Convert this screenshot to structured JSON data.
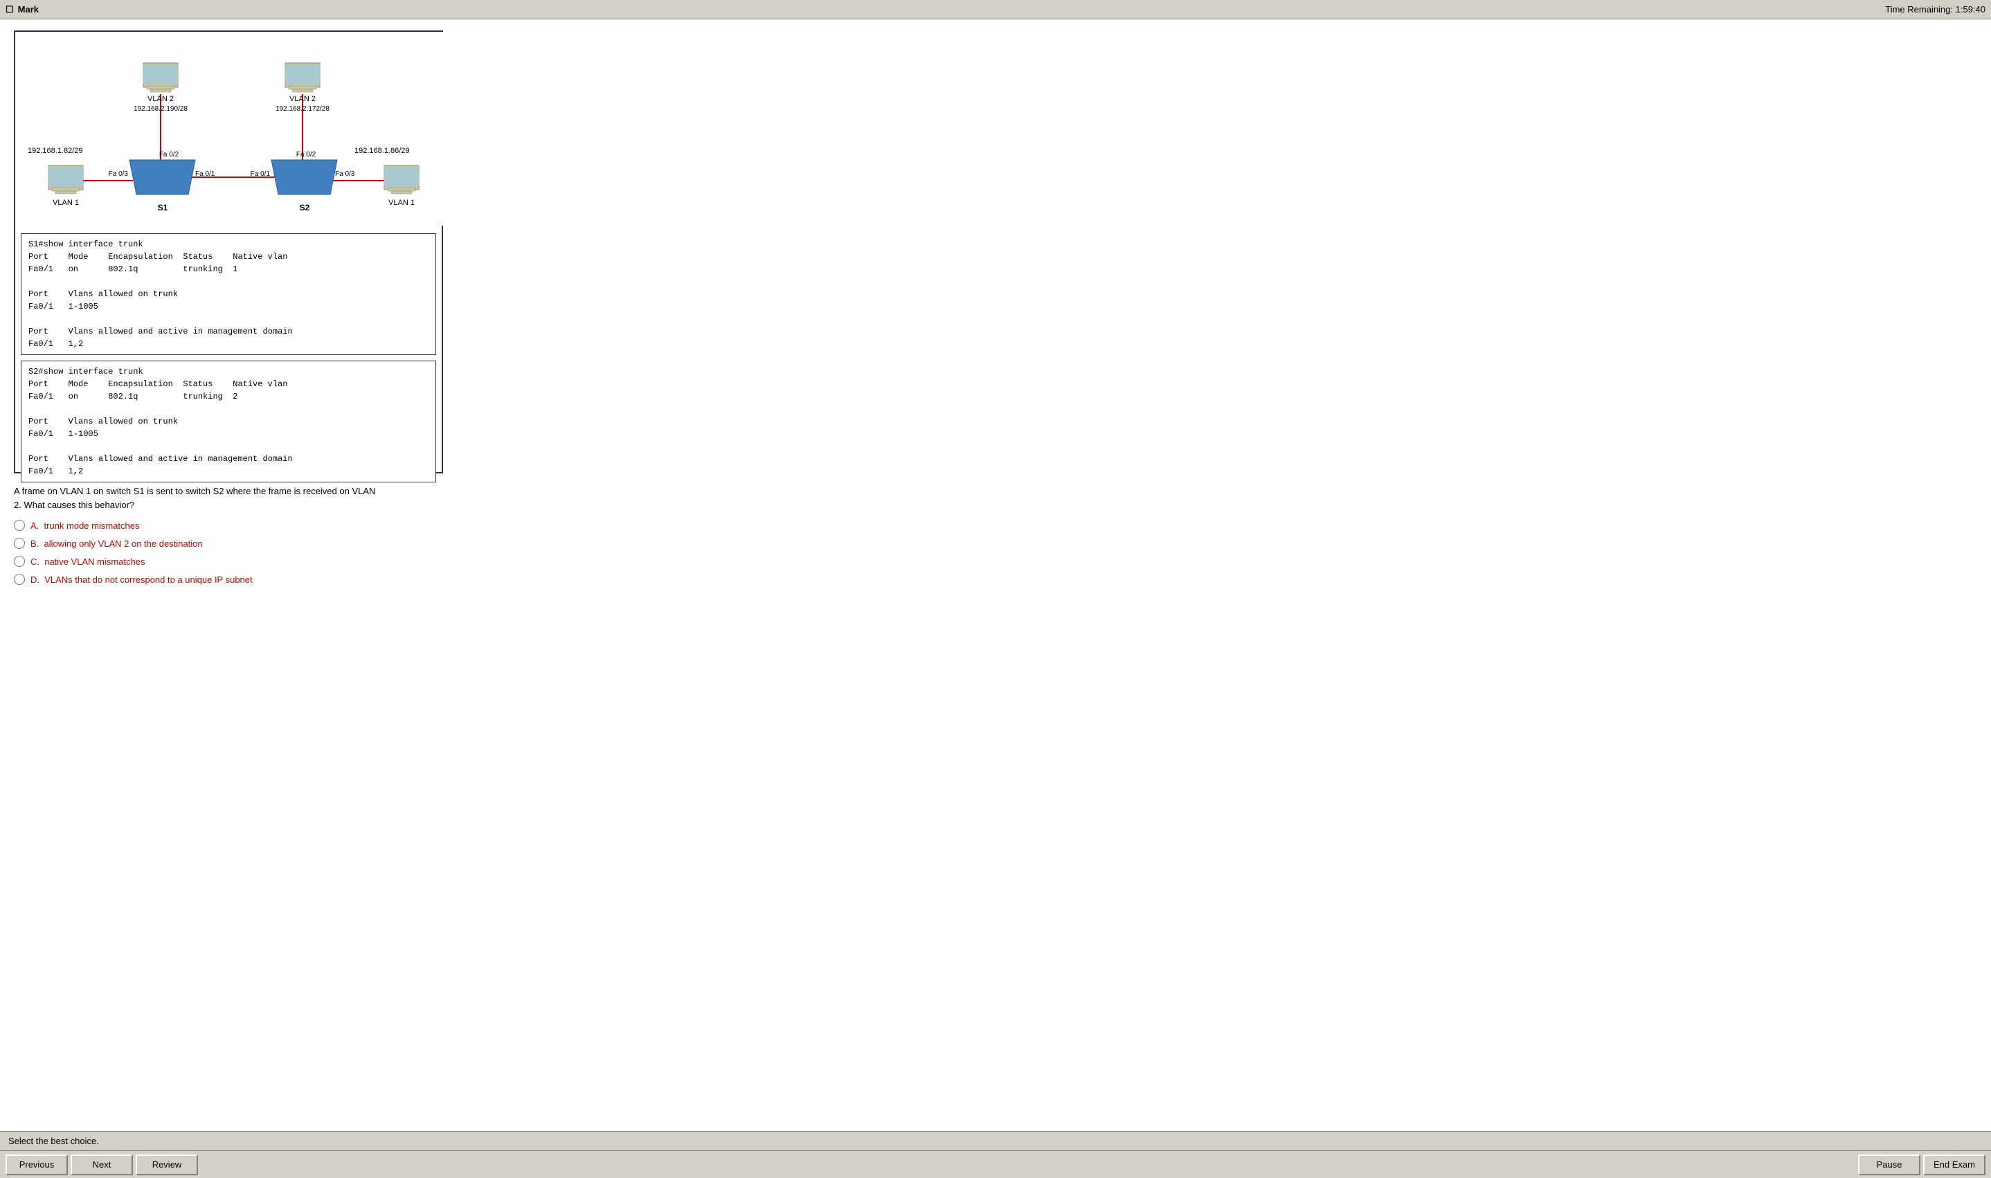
{
  "titlebar": {
    "mark_label": "Mark",
    "time_label": "Time Remaining: 1:59:40"
  },
  "diagram": {
    "s1_output_title": "S1#show interface trunk",
    "s1_table": "Port    Mode    Encapsulation  Status    Native vlan\nFa0/1   on      802.1q         trunking  1\n\nPort    Vlans allowed on trunk\nFa0/1   1-1005\n\nPort    Vlans allowed and active in management domain\nFa0/1   1,2",
    "s2_output_title": "S2#show interface trunk",
    "s2_table": "Port    Mode    Encapsulation  Status    Native vlan\nFa0/1   on      802.1q         trunking  2\n\nPort    Vlans allowed on trunk\nFa0/1   1-1005\n\nPort    Vlans allowed and active in management domain\nFa0/1   1,2"
  },
  "question": {
    "text": "A frame on VLAN 1 on switch S1 is sent to switch S2 where the frame is received on VLAN\n2. What causes this behavior?",
    "options": [
      {
        "id": "A",
        "text": "trunk mode mismatches"
      },
      {
        "id": "B",
        "text": "allowing only VLAN 2 on the destination"
      },
      {
        "id": "C",
        "text": "native VLAN mismatches"
      },
      {
        "id": "D",
        "text": "VLANs that do not correspond to a unique IP subnet"
      }
    ]
  },
  "statusbar": {
    "text": "Select the best choice."
  },
  "buttons": {
    "previous": "Previous",
    "next": "Next",
    "review": "Review",
    "pause": "Pause",
    "end_exam": "End Exam"
  },
  "network": {
    "vlan2_left_ip": "192.168.2.190/28",
    "vlan2_right_ip": "192.168.2.172/28",
    "left_subnet": "192.168.1.82/29",
    "right_subnet": "192.168.1.86/29",
    "s1_label": "S1",
    "s2_label": "S2",
    "fa02_left": "Fa 0/2",
    "fa02_right": "Fa 0/2",
    "fa01_s1": "Fa 0/1",
    "fa01_s2": "Fa 0/1",
    "fa03_left": "Fa 0/3",
    "fa03_right": "Fa 0/3",
    "vlan1_left": "VLAN 1",
    "vlan1_right": "VLAN 1",
    "vlan2_left": "VLAN 2",
    "vlan2_right": "VLAN 2"
  }
}
